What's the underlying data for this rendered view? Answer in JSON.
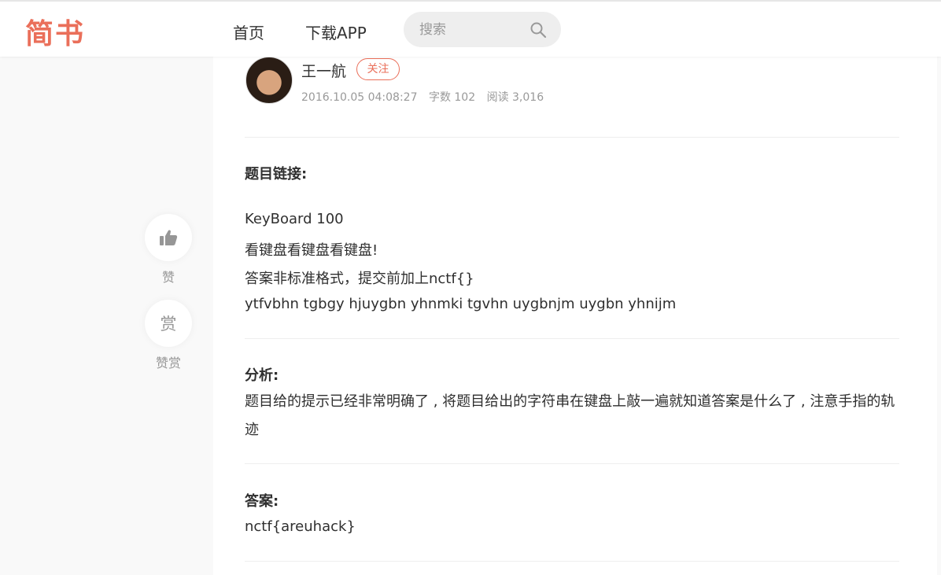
{
  "header": {
    "logo": "简书",
    "nav": {
      "home": "首页",
      "download": "下载APP"
    },
    "search": {
      "placeholder": "搜索"
    }
  },
  "sidebar": {
    "like_label": "赞",
    "reward_icon_char": "赏",
    "reward_label": "赞赏"
  },
  "author": {
    "name": "王一航",
    "follow_label": "关注",
    "date": "2016.10.05 04:08:27",
    "word_count": "字数 102",
    "read_count": "阅读 3,016"
  },
  "article": {
    "sections": [
      {
        "heading": "题目链接:",
        "lines": [
          "KeyBoard 100",
          "看键盘看键盘看键盘!",
          "答案非标准格式，提交前加上nctf{}",
          "ytfvbhn tgbgy hjuygbn yhnmki tgvhn uygbnjm uygbn yhnijm"
        ]
      },
      {
        "heading": "分析:",
        "lines": [
          "题目给的提示已经非常明确了 , 将题目给出的字符串在键盘上敲一遍就知道答案是什么了 , 注意手指的轨迹"
        ]
      },
      {
        "heading": "答案:",
        "lines": [
          "nctf{areuhack}"
        ]
      }
    ]
  },
  "colors": {
    "brand": "#ea6f5a",
    "text": "#2f2f2f",
    "muted": "#999999"
  }
}
